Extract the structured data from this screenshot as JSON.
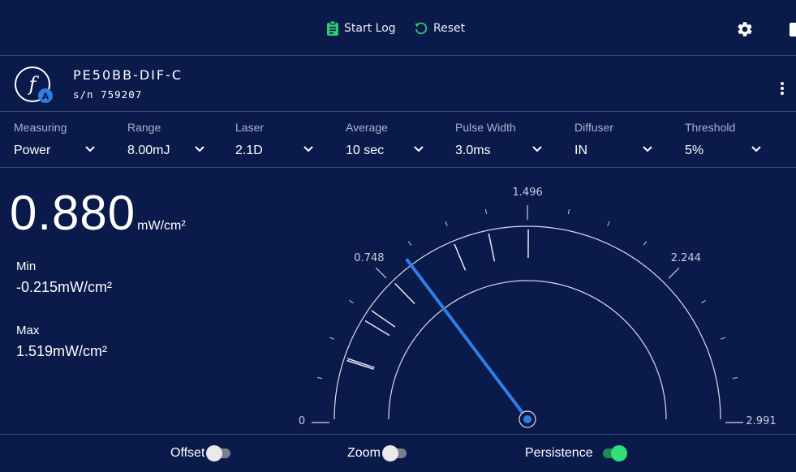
{
  "toolbar": {
    "start_log_label": "Start Log",
    "reset_label": "Reset"
  },
  "device": {
    "logo_letter": "f",
    "logo_badge": "A",
    "name": "PE50BB-DIF-C",
    "serial": "s/n 759207"
  },
  "settings": [
    {
      "label": "Measuring",
      "value": "Power"
    },
    {
      "label": "Range",
      "value": "8.00mJ"
    },
    {
      "label": "Laser",
      "value": "2.1D"
    },
    {
      "label": "Average",
      "value": "10 sec"
    },
    {
      "label": "Pulse Width",
      "value": "3.0ms"
    },
    {
      "label": "Diffuser",
      "value": "IN"
    },
    {
      "label": "Threshold",
      "value": "5%"
    }
  ],
  "reading": {
    "value": "0.880",
    "unit": "mW/cm²",
    "min_label": "Min",
    "min_value": "-0.215mW/cm²",
    "max_label": "Max",
    "max_value": "1.519mW/cm²"
  },
  "gauge": {
    "min": 0,
    "max": 2.991,
    "current": 0.88,
    "tick_labels": [
      "0",
      "0.748",
      "1.496",
      "2.244",
      "2.991"
    ],
    "tick_values": [
      0,
      0.748,
      1.496,
      2.244,
      2.991
    ],
    "persistence_marks": [
      0.3,
      0.31,
      0.52,
      0.58,
      0.76,
      1.12,
      1.3,
      1.5
    ],
    "needle_color": "#2f7ee6"
  },
  "bottom": {
    "offset_label": "Offset",
    "offset_on": false,
    "zoom_label": "Zoom",
    "zoom_on": false,
    "persistence_label": "Persistence",
    "persistence_on": true
  },
  "colors": {
    "background": "#0a1a4a",
    "accent_green": "#2ecc71",
    "needle": "#2f7ee6"
  }
}
